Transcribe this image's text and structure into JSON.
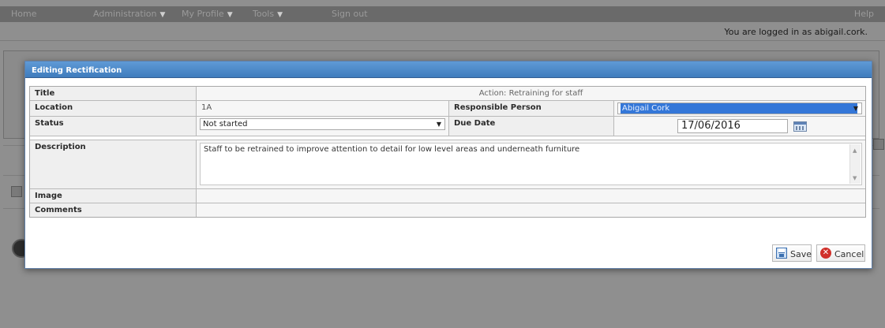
{
  "topnav": {
    "items": [
      {
        "label": "Home",
        "dropdown": false
      },
      {
        "label": "Administration",
        "dropdown": true
      },
      {
        "label": "My Profile",
        "dropdown": true
      },
      {
        "label": "Tools",
        "dropdown": true
      },
      {
        "label": "Sign out",
        "dropdown": false
      }
    ],
    "help_label": "Help"
  },
  "login_status": "You are logged in as abigail.cork.",
  "modal": {
    "title": "Editing Rectification",
    "fields": {
      "title_label": "Title",
      "title_value": "Action: Retraining for staff",
      "location_label": "Location",
      "location_value": "1A",
      "responsible_label": "Responsible Person",
      "responsible_value": "Abigail Cork",
      "status_label": "Status",
      "status_value": "Not started",
      "due_label": "Due Date",
      "due_value": "17/06/2016",
      "description_label": "Description",
      "description_value": "Staff to be retrained to improve attention to detail for low level areas and underneath furniture",
      "image_label": "Image",
      "comments_label": "Comments"
    },
    "buttons": {
      "save": "Save",
      "cancel": "Cancel"
    }
  },
  "colors": {
    "header_blue": "#4a86c6",
    "selection_blue": "#3477d8",
    "cancel_red": "#d0302a",
    "overlay_gray": "#8f8f8f"
  },
  "icons": [
    "calendar-icon",
    "save-icon",
    "cancel-icon",
    "chevron-down-icon"
  ]
}
